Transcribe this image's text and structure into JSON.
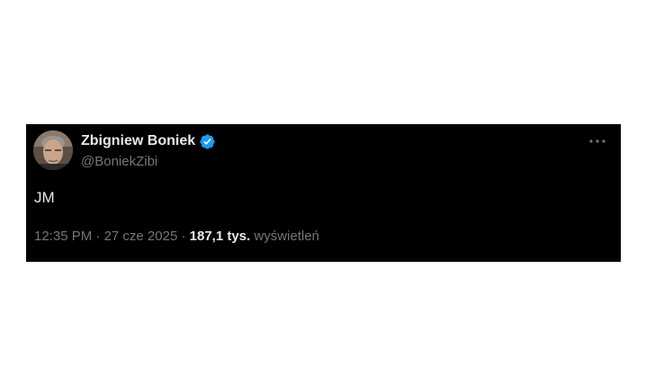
{
  "tweet": {
    "display_name": "Zbigniew Boniek",
    "handle": "@BoniekZibi",
    "text": "JM",
    "time": "12:35 PM",
    "separator_1": " · ",
    "date": "27 cze 2025",
    "separator_2": " · ",
    "views_count": "187,1 tys.",
    "views_label": " wyświetleń"
  },
  "icons": {
    "verified": "verified-badge-icon",
    "more": "more-options-icon",
    "avatar": "profile-avatar"
  },
  "colors": {
    "card_background": "#000000",
    "page_background": "#ffffff",
    "primary_text": "#e7e9ea",
    "secondary_text": "#71767b",
    "verified_blue": "#1d9bf0"
  }
}
